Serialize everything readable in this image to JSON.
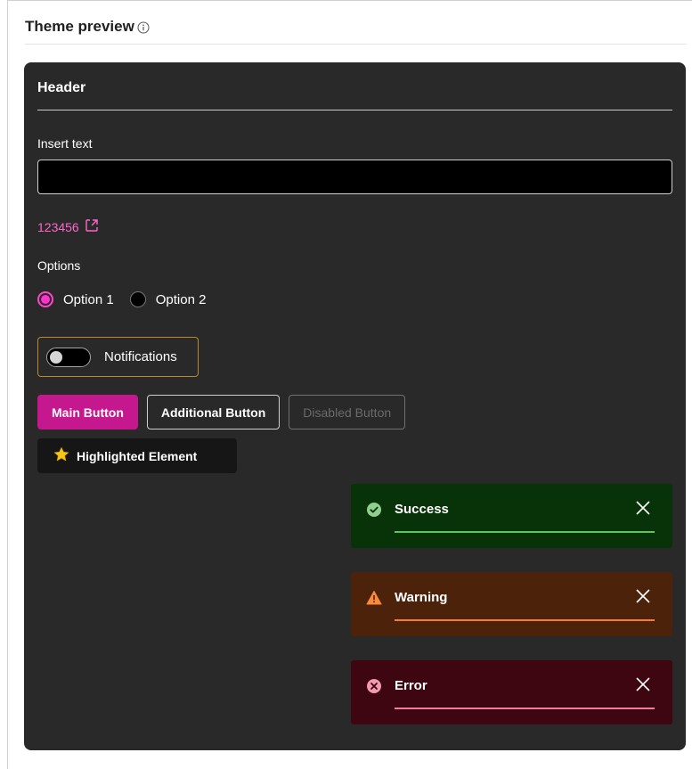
{
  "pane": {
    "title": "Theme preview",
    "info_icon": "info-circle-icon"
  },
  "preview": {
    "header": "Header",
    "insert_label": "Insert text",
    "input_value": "",
    "link_text": "123456",
    "link_icon": "external-link-icon",
    "options_label": "Options",
    "radio_options": [
      {
        "label": "Option 1",
        "checked": true
      },
      {
        "label": "Option 2",
        "checked": false
      }
    ],
    "toggle": {
      "label": "Notifications",
      "on": false
    },
    "buttons": {
      "main": "Main Button",
      "additional": "Additional Button",
      "disabled": "Disabled Button"
    },
    "highlight": {
      "label": "Highlighted Element",
      "icon": "star-icon"
    },
    "toasts": {
      "success": "Success",
      "warning": "Warning",
      "error": "Error"
    }
  },
  "colors": {
    "accent": "#c5188f",
    "link": "#ff66cc",
    "panel_background": "#292929",
    "success_bg": "#083208",
    "warning_bg": "#4d220a",
    "error_bg": "#3e0610"
  }
}
